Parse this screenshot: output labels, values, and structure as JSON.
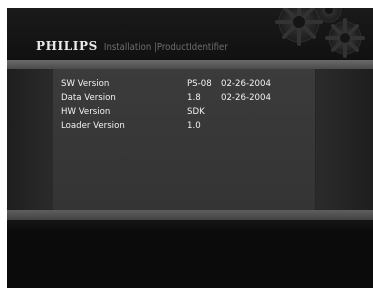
{
  "header": {
    "brand": "PHILIPS",
    "breadcrumb": "Installation |ProductIdentifier"
  },
  "versions": [
    {
      "label": "SW Version",
      "version": "PS-08",
      "date": "02-26-2004"
    },
    {
      "label": "Data Version",
      "version": "1.8",
      "date": "02-26-2004"
    },
    {
      "label": "HW Version",
      "version": "SDK",
      "date": ""
    },
    {
      "label": "Loader Version",
      "version": "1.0",
      "date": ""
    }
  ]
}
